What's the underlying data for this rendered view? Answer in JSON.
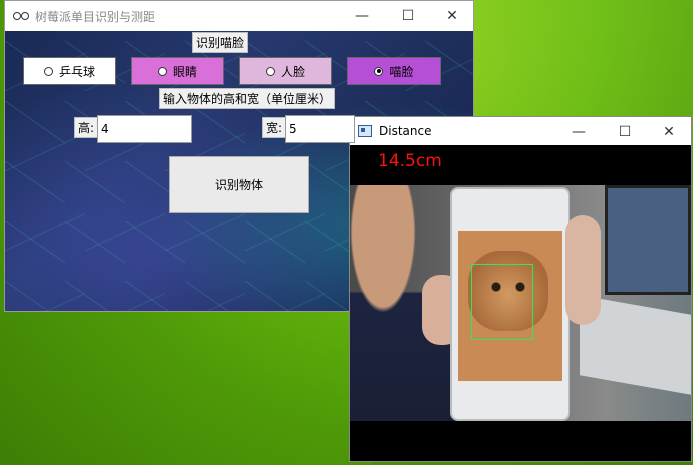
{
  "main_window": {
    "title": "树莓派单目识别与测距",
    "controls": {
      "minimize": "—",
      "maximize": "☐",
      "close": "✕"
    },
    "recognize_face_label": "识别喵脸",
    "radio_options": [
      {
        "label": "乒乓球",
        "checked": false,
        "bg": "#ffffff"
      },
      {
        "label": "眼睛",
        "checked": false,
        "bg": "#d96fd8"
      },
      {
        "label": "人脸",
        "checked": false,
        "bg": "#dfb6dc"
      },
      {
        "label": "喵脸",
        "checked": true,
        "bg": "#b44fd6"
      }
    ],
    "size_prompt": "输入物体的高和宽（单位厘米）",
    "height_label": "高:",
    "height_value": "4",
    "width_label": "宽:",
    "width_value": "5",
    "identify_button": "识别物体"
  },
  "distance_window": {
    "title": "Distance",
    "controls": {
      "minimize": "—",
      "maximize": "☐",
      "close": "✕"
    },
    "distance_reading": "14.5cm",
    "detect_box_color": "#2ee85a",
    "reading_color": "#ff1010"
  }
}
